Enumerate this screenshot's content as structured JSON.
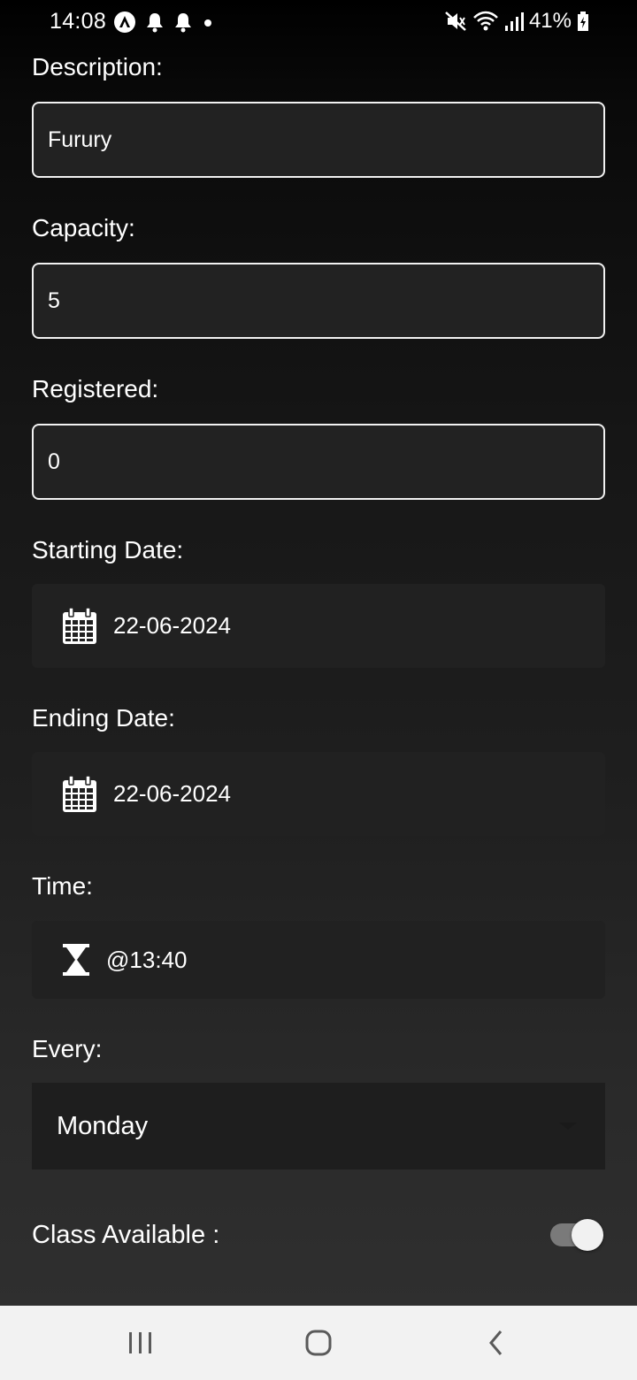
{
  "status_bar": {
    "time": "14:08",
    "left_icons": [
      "app-logo-icon",
      "bell-icon",
      "bell-icon",
      "dot-icon"
    ],
    "right_icons": [
      "mute-icon",
      "wifi-icon",
      "signal-icon"
    ],
    "battery": "41%"
  },
  "form": {
    "description": {
      "label": "Description:",
      "value": "Furury"
    },
    "capacity": {
      "label": "Capacity:",
      "value": "5"
    },
    "registered": {
      "label": "Registered:",
      "value": "0"
    },
    "starting_date": {
      "label": "Starting Date:",
      "value": "22-06-2024",
      "icon": "calendar-icon"
    },
    "ending_date": {
      "label": "Ending Date:",
      "value": "22-06-2024",
      "icon": "calendar-icon"
    },
    "time": {
      "label": "Time:",
      "value": "@13:40",
      "icon": "hourglass-icon"
    },
    "every": {
      "label": "Every:",
      "value": "Monday"
    },
    "class_available": {
      "label": "Class Available :",
      "enabled": true
    }
  },
  "nav_bar": {
    "buttons": [
      "recent-apps",
      "home",
      "back"
    ],
    "background": "#f2f2f2"
  },
  "colors": {
    "background_top": "#000000",
    "background_bottom": "#2f2f2f",
    "field_fill": "#222222",
    "text": "#ffffff"
  }
}
